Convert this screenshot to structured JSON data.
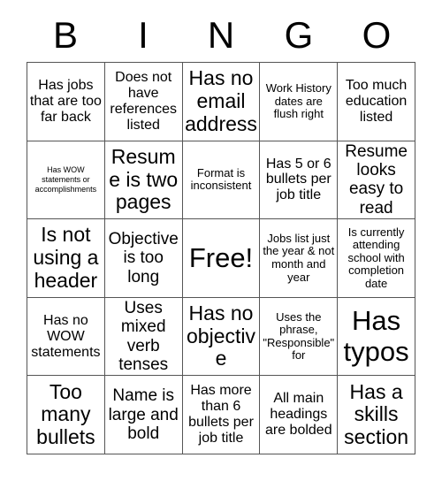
{
  "header": {
    "letters": [
      "B",
      "I",
      "N",
      "G",
      "O"
    ]
  },
  "grid": {
    "rows": [
      [
        {
          "text": "Has jobs that are too far back",
          "size": "md"
        },
        {
          "text": "Does not have references listed",
          "size": "md"
        },
        {
          "text": "Has no email address",
          "size": "xl"
        },
        {
          "text": "Work History dates are flush right",
          "size": "sm"
        },
        {
          "text": "Too much education listed",
          "size": "md"
        }
      ],
      [
        {
          "text": "Has WOW statements or accomplishments",
          "size": "xs"
        },
        {
          "text": "Resume is two pages",
          "size": "xl"
        },
        {
          "text": "Format is inconsistent",
          "size": "sm"
        },
        {
          "text": "Has 5 or 6 bullets per job title",
          "size": "md"
        },
        {
          "text": "Resume looks easy to read",
          "size": "lg"
        }
      ],
      [
        {
          "text": "Is not using a header",
          "size": "xl"
        },
        {
          "text": "Objective is too long",
          "size": "lg"
        },
        {
          "text": "Free!",
          "size": "xxl"
        },
        {
          "text": "Jobs list just the year & not month and year",
          "size": "sm"
        },
        {
          "text": "Is currently attending school with completion date",
          "size": "sm"
        }
      ],
      [
        {
          "text": "Has no WOW statements",
          "size": "md"
        },
        {
          "text": "Uses mixed verb tenses",
          "size": "lg"
        },
        {
          "text": "Has no objective",
          "size": "xl"
        },
        {
          "text": "Uses the phrase, \"Responsible\" for",
          "size": "sm"
        },
        {
          "text": "Has typos",
          "size": "xxl"
        }
      ],
      [
        {
          "text": "Too many bullets",
          "size": "xl"
        },
        {
          "text": "Name is large and bold",
          "size": "lg"
        },
        {
          "text": "Has more than 6 bullets per job title",
          "size": "md"
        },
        {
          "text": "All main headings are bolded",
          "size": "md"
        },
        {
          "text": "Has a skills section",
          "size": "xl"
        }
      ]
    ]
  }
}
